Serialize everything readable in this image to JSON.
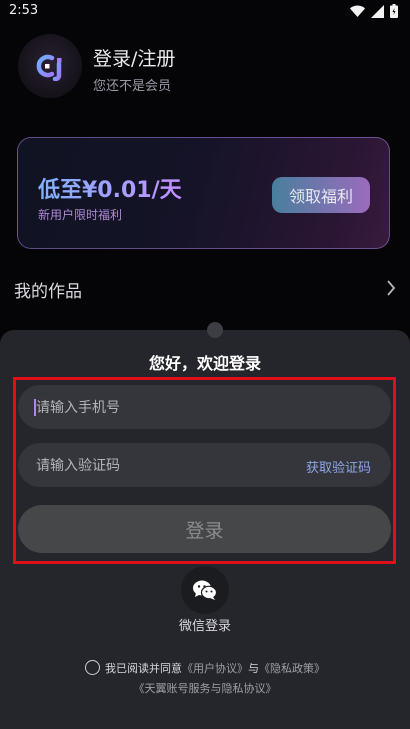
{
  "status_bar": {
    "time": "2:53"
  },
  "profile": {
    "title": "登录/注册",
    "subtitle": "您还不是会员"
  },
  "promo": {
    "price": "低至¥0.01/天",
    "subtitle": "新用户限时福利",
    "button": "领取福利"
  },
  "works": {
    "label": "我的作品"
  },
  "sheet": {
    "title": "您好，欢迎登录",
    "phone_placeholder": "请输入手机号",
    "code_placeholder": "请输入验证码",
    "get_code": "获取验证码",
    "login_button": "登录",
    "wechat_label": "微信登录",
    "agree_prefix": "我已阅读并同意",
    "user_agreement": "《用户协议》",
    "and": "与",
    "privacy_policy": "《隐私政策》",
    "account_agreement": "《天翼账号服务与隐私协议》"
  },
  "colors": {
    "accent": "#b087e8",
    "outline": "#e0101b",
    "sheet_bg": "#25262b"
  }
}
